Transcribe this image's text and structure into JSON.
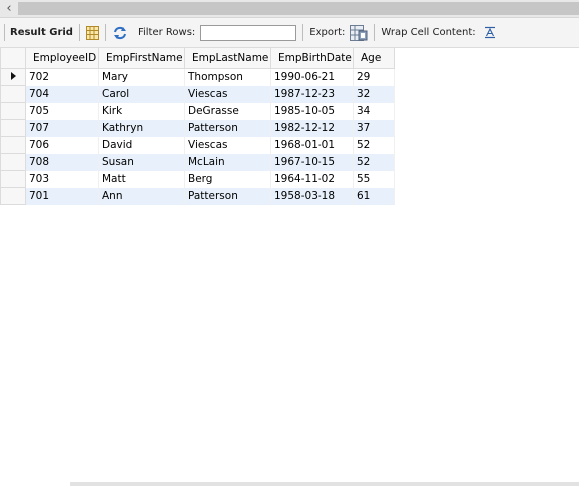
{
  "toolbar": {
    "result_grid_label": "Result Grid",
    "filter_rows_label": "Filter Rows:",
    "filter_value": "",
    "export_label": "Export:",
    "wrap_label": "Wrap Cell Content:"
  },
  "columns": [
    "EmployeeID",
    "EmpFirstName",
    "EmpLastName",
    "EmpBirthDate",
    "Age"
  ],
  "rows": [
    [
      "702",
      "Mary",
      "Thompson",
      "1990-06-21",
      "29"
    ],
    [
      "704",
      "Carol",
      "Viescas",
      "1987-12-23",
      "32"
    ],
    [
      "705",
      "Kirk",
      "DeGrasse",
      "1985-10-05",
      "34"
    ],
    [
      "707",
      "Kathryn",
      "Patterson",
      "1982-12-12",
      "37"
    ],
    [
      "706",
      "David",
      "Viescas",
      "1968-01-01",
      "52"
    ],
    [
      "708",
      "Susan",
      "McLain",
      "1967-10-15",
      "52"
    ],
    [
      "703",
      "Matt",
      "Berg",
      "1964-11-02",
      "55"
    ],
    [
      "701",
      "Ann",
      "Patterson",
      "1958-03-18",
      "61"
    ]
  ],
  "selected_row": 0
}
